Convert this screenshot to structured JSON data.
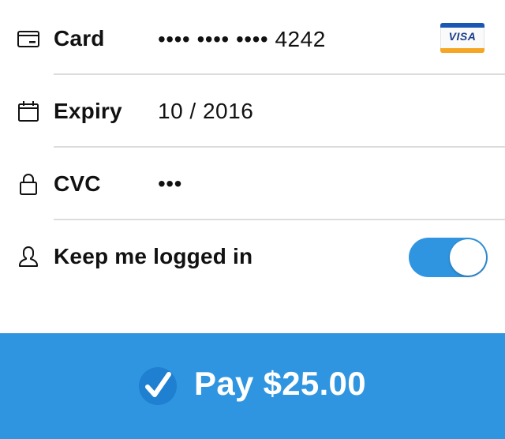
{
  "card": {
    "label": "Card",
    "value": "•••• •••• •••• 4242",
    "icon": "credit-card-icon",
    "brand": "VISA"
  },
  "expiry": {
    "label": "Expiry",
    "value": "10 / 2016",
    "icon": "calendar-icon"
  },
  "cvc": {
    "label": "CVC",
    "value": "•••",
    "icon": "lock-icon"
  },
  "keep_logged_in": {
    "label": "Keep me logged in",
    "icon": "person-icon",
    "enabled": true
  },
  "pay_button": {
    "label": "Pay $25.00",
    "icon": "checkmark-icon"
  },
  "colors": {
    "accent": "#3095e0",
    "divider": "#dcdcdc",
    "visa_blue": "#1a56b3",
    "visa_gold": "#f5a623"
  }
}
